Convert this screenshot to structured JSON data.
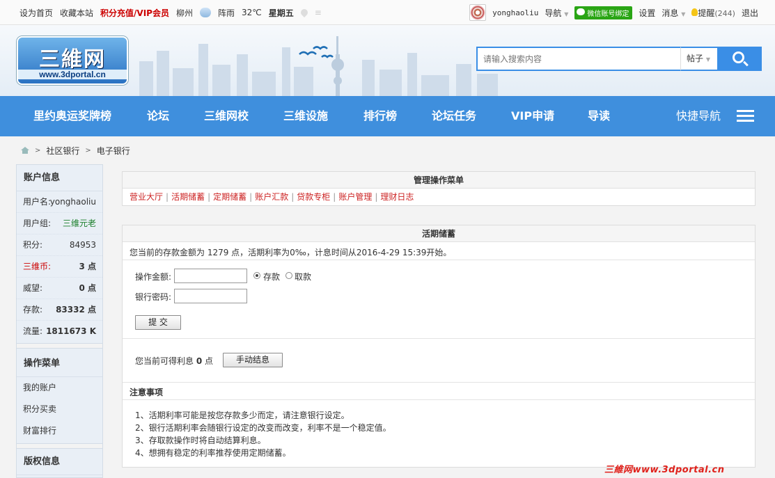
{
  "topbar": {
    "links": [
      "设为首页",
      "收藏本站"
    ],
    "vip": "积分充值/VIP会员",
    "city": "柳州",
    "weather": "阵雨",
    "temperature": "32℃",
    "weekday": "星期五",
    "username": "yonghaoliu",
    "nav_label": "导航",
    "wechat": "微信账号绑定",
    "settings": "设置",
    "messages": "消息",
    "remind": "提醒",
    "remind_count": "(244)",
    "logout": "退出"
  },
  "header": {
    "logo_text": "三維网",
    "logo_url": "www.3dportal.cn",
    "search_placeholder": "请输入搜索内容",
    "search_type": "帖子"
  },
  "nav": {
    "items": [
      "里约奥运奖牌榜",
      "论坛",
      "三维网校",
      "三维设施",
      "排行榜",
      "论坛任务",
      "VIP申请",
      "导读"
    ],
    "quick": "快捷导航"
  },
  "breadcrumb": [
    "社区银行",
    "电子银行"
  ],
  "sidebar": {
    "account_title": "账户信息",
    "rows": [
      {
        "label": "用户名:",
        "value": "yonghaoliu"
      },
      {
        "label": "用户组:",
        "value": "三维元老"
      },
      {
        "label": "积分:",
        "value": "84953"
      },
      {
        "label": "三维币:",
        "value": "3 点"
      },
      {
        "label": "威望:",
        "value": "0 点"
      },
      {
        "label": "存款:",
        "value": "83332 点"
      },
      {
        "label": "流量:",
        "value": "1811673 K"
      }
    ],
    "ops_title": "操作菜单",
    "ops": [
      "我的账户",
      "积分买卖",
      "财富排行"
    ],
    "copyright_title": "版权信息"
  },
  "menu_panel": {
    "title": "管理操作菜单",
    "links": [
      "营业大厅",
      "活期储蓄",
      "定期储蓄",
      "账户汇款",
      "贷款专柜",
      "账户管理",
      "理财日志"
    ]
  },
  "savings": {
    "title": "活期储蓄",
    "info": "您当前的存款金额为 1279 点，活期利率为0‰，计息时间从2016-4-29 15:39开始。",
    "amount_label": "操作金额:",
    "deposit": "存款",
    "withdraw": "取款",
    "password_label": "银行密码:",
    "submit": "提 交",
    "interest_prefix": "您当前可得利息",
    "interest_value": "0",
    "interest_unit": "点",
    "settle_button": "手动结息",
    "notes_title": "注意事项",
    "notes": [
      "1、活期利率可能是按您存款多少而定，请注意银行设定。",
      "2、银行活期利率会随银行设定的改变而改变，利率不是一个稳定值。",
      "3、存取款操作时将自动结算利息。",
      "4、想拥有稳定的利率推荐使用定期储蓄。"
    ]
  },
  "watermark": "三維网www.3dportal.cn"
}
